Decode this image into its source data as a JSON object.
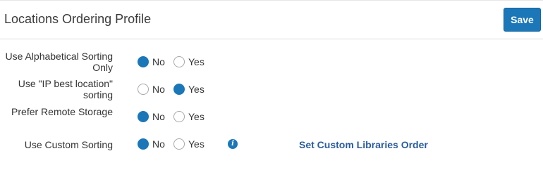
{
  "header": {
    "title": "Locations Ordering Profile",
    "save_label": "Save"
  },
  "fields": [
    {
      "label": "Use Alphabetical Sorting Only",
      "options": [
        "No",
        "Yes"
      ],
      "selected": "No"
    },
    {
      "label": "Use \"IP best location\" sorting",
      "options": [
        "No",
        "Yes"
      ],
      "selected": "Yes"
    },
    {
      "label": "Prefer Remote Storage",
      "options": [
        "No",
        "Yes"
      ],
      "selected": "No"
    },
    {
      "label": "Use Custom Sorting",
      "options": [
        "No",
        "Yes"
      ],
      "selected": "No",
      "info_icon": "info-icon",
      "link_label": "Set Custom Libraries Order"
    }
  ],
  "colors": {
    "accent": "#1b77b8",
    "link": "#2b5ca0"
  }
}
